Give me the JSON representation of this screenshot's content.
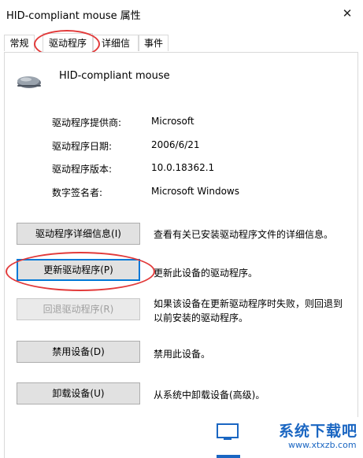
{
  "window": {
    "title": "HID-compliant mouse 属性",
    "close_glyph": "✕"
  },
  "tabs": [
    {
      "label": "常规"
    },
    {
      "label": "驱动程序"
    },
    {
      "label": "详细信息"
    },
    {
      "label": "事件"
    }
  ],
  "active_tab": "驱动程序",
  "device": {
    "name": "HID-compliant mouse",
    "icon": "mouse-icon"
  },
  "driver_info": [
    {
      "label": "驱动程序提供商:",
      "value": "Microsoft"
    },
    {
      "label": "驱动程序日期:",
      "value": "2006/6/21"
    },
    {
      "label": "驱动程序版本:",
      "value": "10.0.18362.1"
    },
    {
      "label": "数字签名者:",
      "value": "Microsoft Windows"
    }
  ],
  "actions": [
    {
      "button": "驱动程序详细信息(I)",
      "description": "查看有关已安装驱动程序文件的详细信息。"
    },
    {
      "button": "更新驱动程序(P)",
      "description": "更新此设备的驱动程序。"
    },
    {
      "button": "回退驱动程序(R)",
      "description_line1": "如果该设备在更新驱动程序时失败，则回退到",
      "description_line2": "以前安装的驱动程序。"
    },
    {
      "button": "禁用设备(D)",
      "description": "禁用此设备。"
    },
    {
      "button": "卸载设备(U)",
      "description": "从系统中卸载设备(高级)。"
    }
  ],
  "watermark": {
    "brand": "系统下载吧",
    "url": "www.xtxzb.com"
  },
  "colors": {
    "annotation": "#e23a3a",
    "focus": "#0078d7",
    "watermark": "#1a66c2"
  }
}
